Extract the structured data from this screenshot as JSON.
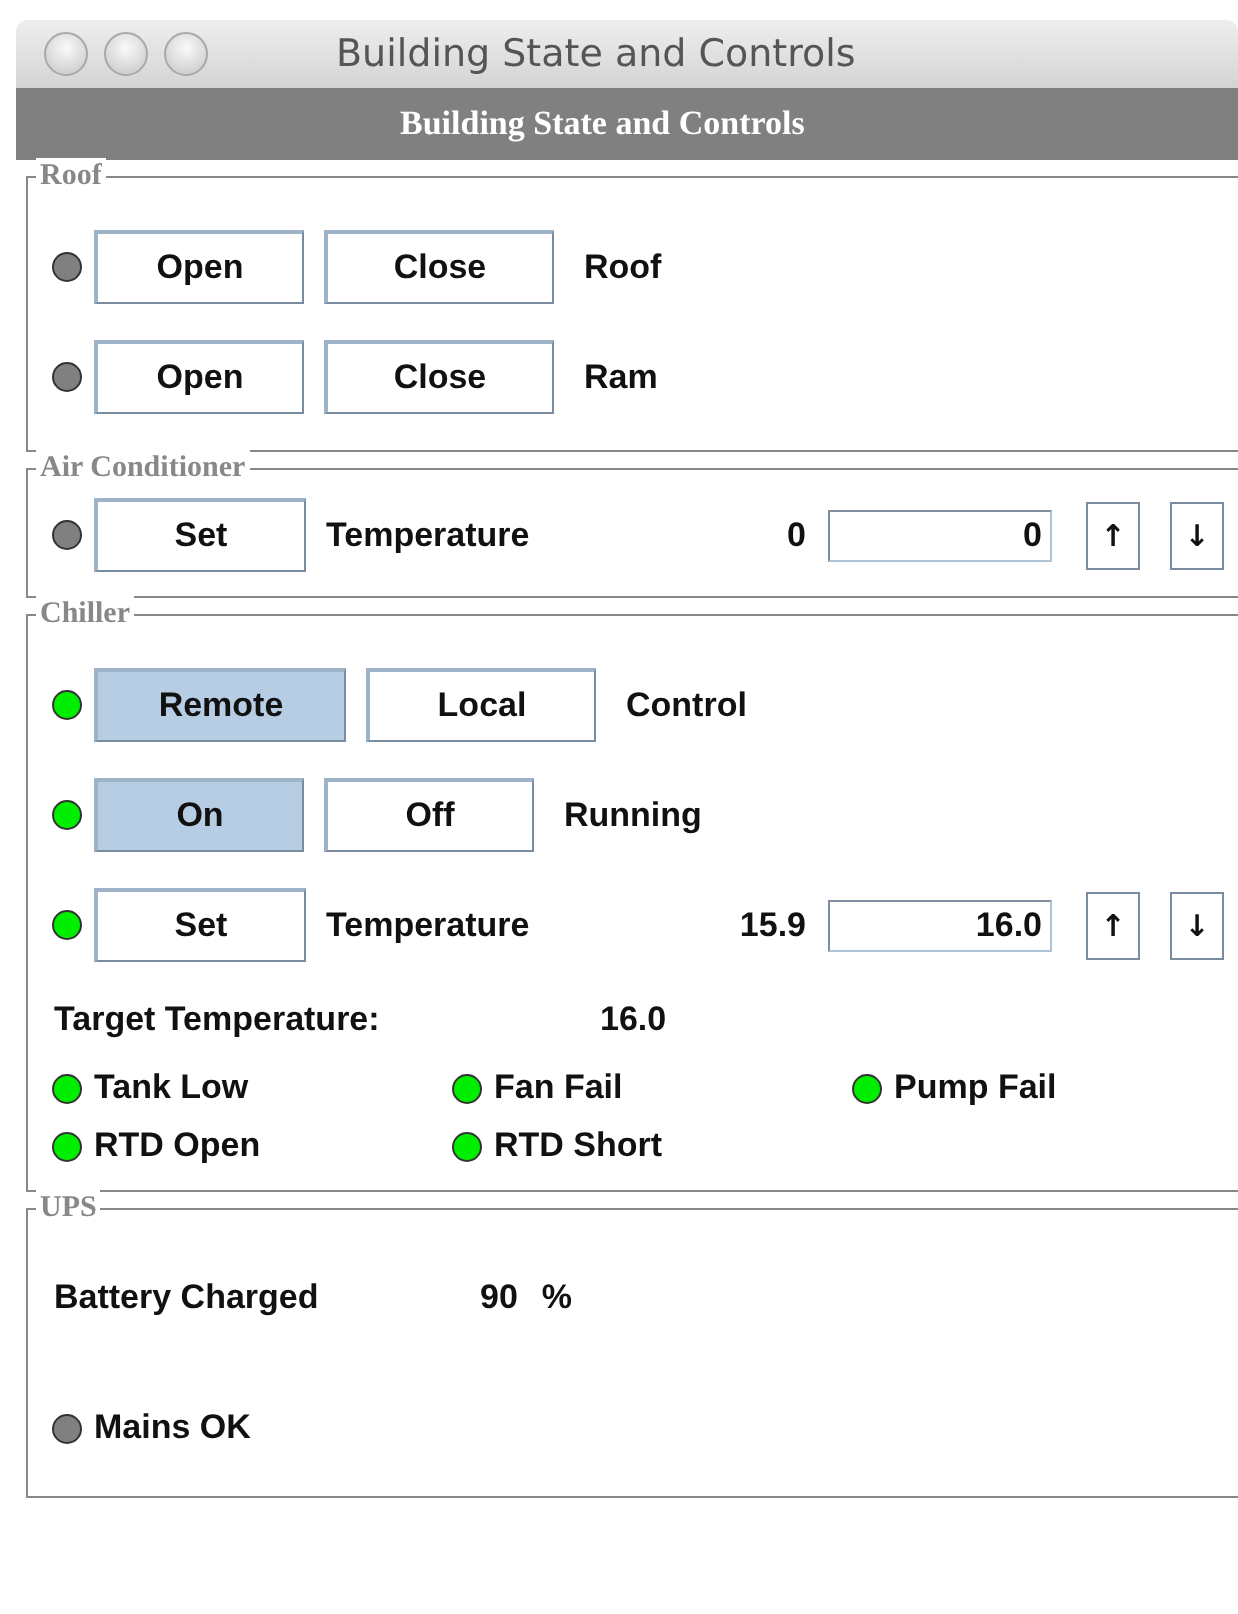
{
  "window": {
    "title": "Building State and Controls"
  },
  "header": {
    "title": "Building State and Controls"
  },
  "sections": [
    {
      "title": "Roof",
      "rows": [
        {
          "kind": "buttons",
          "color": "#808080",
          "buttons": [
            {
              "label": "Open",
              "selected": false
            },
            {
              "label": "Close",
              "selected": false
            }
          ],
          "label": "Roof"
        },
        {
          "kind": "buttons",
          "color": "#808080",
          "buttons": [
            {
              "label": "Open",
              "selected": false
            },
            {
              "label": "Close",
              "selected": false
            }
          ],
          "label": "Ram"
        }
      ]
    },
    {
      "title": "Air Conditioner",
      "rows": [
        {
          "kind": "setpoint",
          "color": "#808080",
          "button": {
            "label": "Set",
            "selected": false
          },
          "label": "Temperature",
          "reading": "0",
          "value": "0",
          "up": "↑",
          "down": "↓"
        }
      ]
    },
    {
      "title": "Chiller",
      "rows": [
        {
          "kind": "buttons",
          "color": "#00ee00",
          "buttons": [
            {
              "label": "Remote",
              "selected": true
            },
            {
              "label": "Local",
              "selected": false
            }
          ],
          "label": "Control"
        },
        {
          "kind": "buttons",
          "color": "#00ee00",
          "buttons": [
            {
              "label": "On",
              "selected": true
            },
            {
              "label": "Off",
              "selected": false
            }
          ],
          "label": "Running"
        },
        {
          "kind": "setpoint",
          "color": "#00ee00",
          "button": {
            "label": "Set",
            "selected": false
          },
          "label": "Temperature",
          "reading": "15.9",
          "value": "16.0",
          "up": "↑",
          "down": "↓"
        },
        {
          "kind": "readout",
          "label": "Target Temperature:",
          "value": "16.0"
        },
        {
          "kind": "flags",
          "items": [
            {
              "label": "Tank Low",
              "color": "#00ee00"
            },
            {
              "label": "Fan Fail",
              "color": "#00ee00"
            },
            {
              "label": "Pump Fail",
              "color": "#00ee00"
            },
            {
              "label": "RTD Open",
              "color": "#00ee00"
            },
            {
              "label": "RTD Short",
              "color": "#00ee00"
            }
          ]
        }
      ]
    },
    {
      "title": "UPS",
      "rows": [
        {
          "kind": "readout",
          "label": "Battery Charged",
          "value": "90",
          "unit": "%"
        },
        {
          "kind": "flags",
          "items": [
            {
              "label": "Mains OK",
              "color": "#808080"
            }
          ]
        }
      ]
    }
  ]
}
